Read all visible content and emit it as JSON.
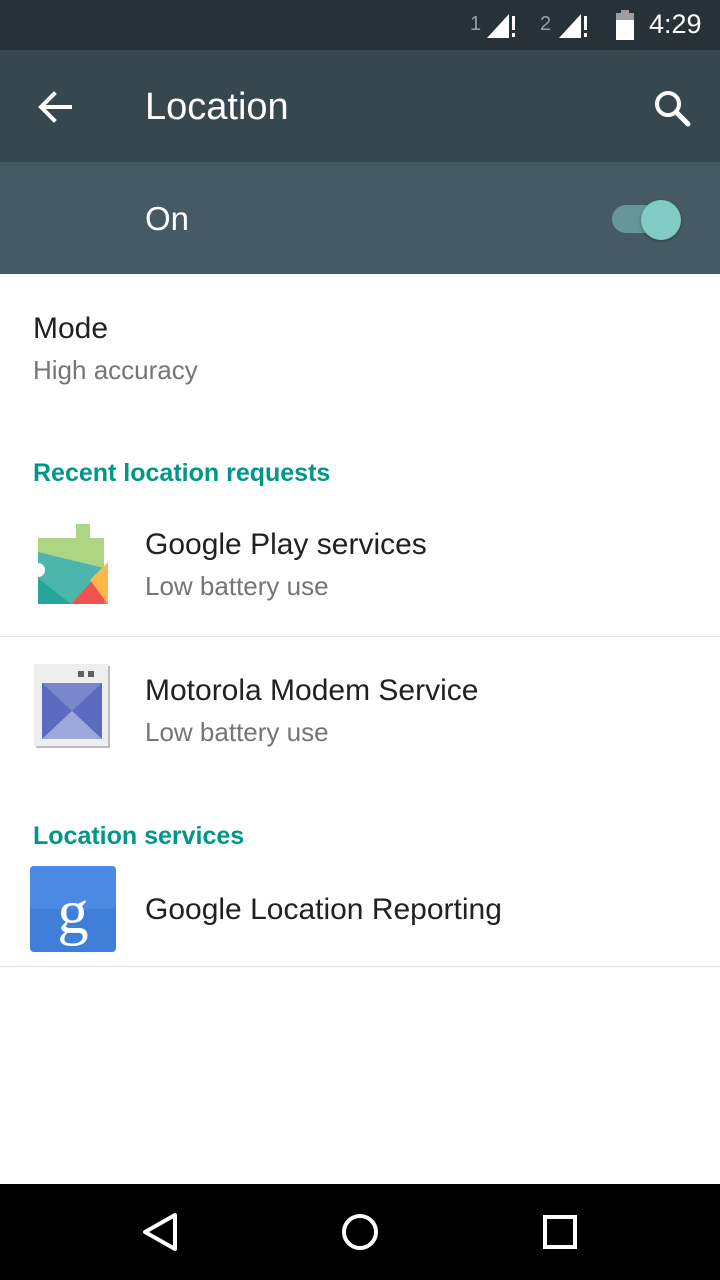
{
  "status_bar": {
    "sim1_label": "1",
    "sim2_label": "2",
    "time": "4:29",
    "icons": [
      "signal-icon",
      "signal-icon",
      "battery-icon"
    ]
  },
  "toolbar": {
    "title": "Location",
    "back_icon": "arrow-back-icon",
    "search_icon": "search-icon"
  },
  "master_switch": {
    "label": "On",
    "checked": true,
    "accent_color": "#80cbc4"
  },
  "mode": {
    "title": "Mode",
    "value": "High accuracy"
  },
  "recent_requests": {
    "header": "Recent location requests",
    "items": [
      {
        "name": "Google Play services",
        "battery": "Low battery use",
        "icon": "google-play-services-icon"
      },
      {
        "name": "Motorola Modem Service",
        "battery": "Low battery use",
        "icon": "motorola-modem-icon"
      }
    ]
  },
  "location_services": {
    "header": "Location services",
    "items": [
      {
        "name": "Google Location Reporting",
        "icon": "google-g-icon"
      }
    ]
  },
  "nav_bar": {
    "buttons": [
      "back-triangle-icon",
      "home-circle-icon",
      "recents-square-icon"
    ]
  },
  "colors": {
    "status_bar": "#263238",
    "toolbar": "#37474f",
    "switch_bar": "#455a64",
    "section_header": "#009688"
  }
}
